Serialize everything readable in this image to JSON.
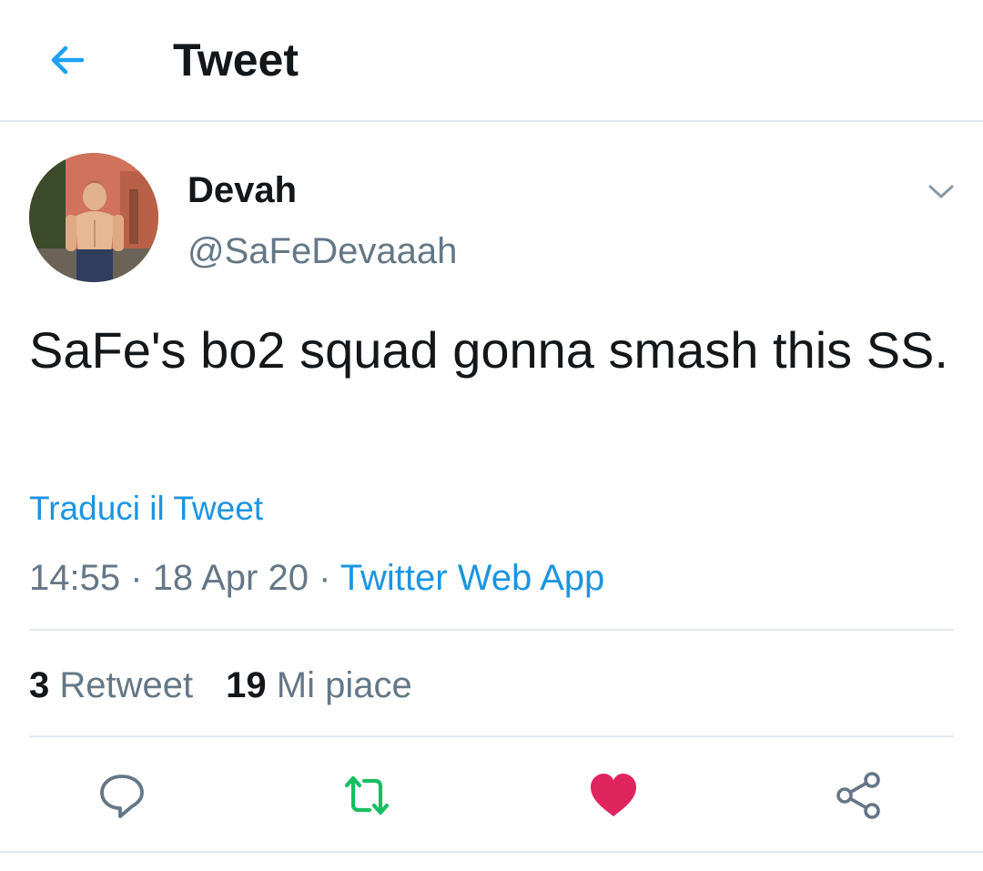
{
  "header": {
    "title": "Tweet",
    "back_icon": "arrow-left-icon"
  },
  "tweet": {
    "author": {
      "display_name": "Devah",
      "handle": "@SaFeDevaaah"
    },
    "text": "SaFe's bo2 squad gonna smash this SS.",
    "translate_label": "Traduci il Tweet",
    "time": "14:55",
    "separator": "·",
    "date": "18 Apr 20",
    "source": "Twitter Web App",
    "stats": {
      "retweets_count": "3",
      "retweets_label": "Retweet",
      "likes_count": "19",
      "likes_label": "Mi piace"
    }
  },
  "actions": [
    {
      "icon": "reply-icon"
    },
    {
      "icon": "retweet-icon"
    },
    {
      "icon": "heart-icon"
    },
    {
      "icon": "share-icon"
    }
  ],
  "colors": {
    "accent": "#1da1f2",
    "link": "#1b95e0",
    "retweet": "#17bf63",
    "like": "#e0245e",
    "secondary_text": "#657786",
    "divider": "#e1e8ed"
  }
}
